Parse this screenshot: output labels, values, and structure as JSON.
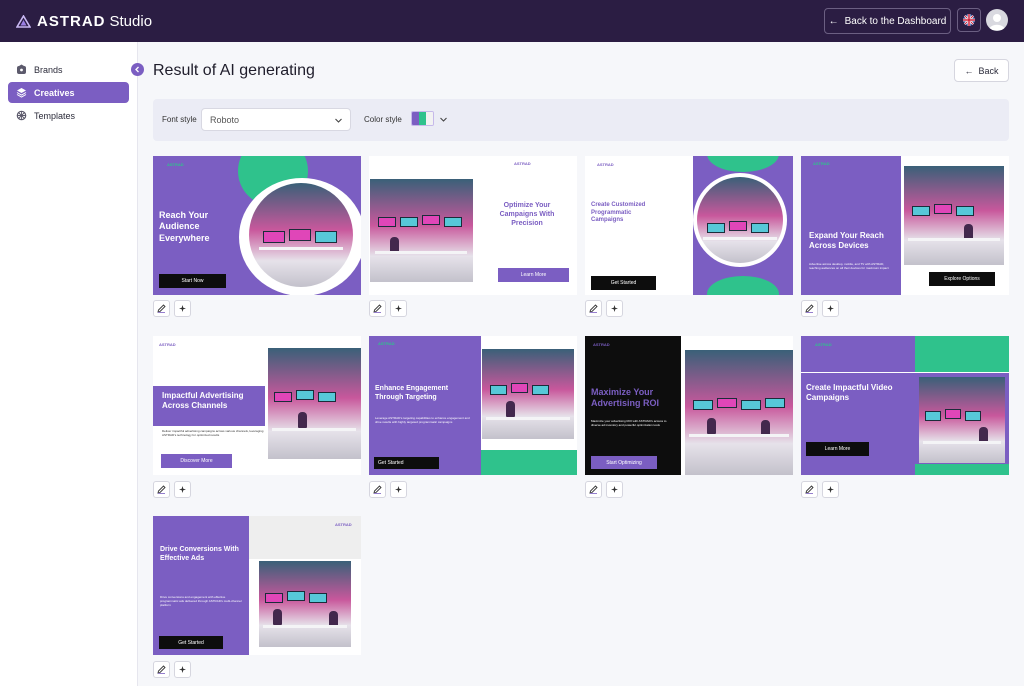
{
  "app": {
    "brand": "ASTRAD",
    "product": "Studio"
  },
  "topbar": {
    "back_to_dashboard": "Back to the Dashboard",
    "language_flag": "uk-flag-icon",
    "avatar": "user-avatar"
  },
  "sidebar": {
    "items": [
      {
        "label": "Brands",
        "icon": "brand-icon",
        "active": false
      },
      {
        "label": "Creatives",
        "icon": "layers-icon",
        "active": true
      },
      {
        "label": "Templates",
        "icon": "templates-icon",
        "active": false
      }
    ]
  },
  "page": {
    "title": "Result of AI generating",
    "back_label": "Back"
  },
  "filters": {
    "font_style_label": "Font style",
    "font_style_value": "Roboto",
    "color_style_label": "Color style"
  },
  "colors": {
    "accent": "#7b5ec2",
    "topbar": "#2b1d43",
    "green": "#2fc28c",
    "black": "#0d0d0d"
  },
  "creatives": [
    {
      "logo": "ASTRAD",
      "title": "Reach Your Audience Everywhere",
      "cta": "Start Now"
    },
    {
      "logo": "ASTRAD",
      "title": "Optimize Your Campaigns With Precision",
      "cta": "Learn More"
    },
    {
      "logo": "ASTRAD",
      "title": "Create Customized Programmatic Campaigns",
      "cta": "Get Started"
    },
    {
      "logo": "ASTRAD",
      "title": "Expand Your Reach Across Devices",
      "body": "Advertise across desktop, mobile, and TV with ASTRAD, reaching audiences on all their devices for maximum impact",
      "cta": "Explore Options"
    },
    {
      "logo": "ASTRAD",
      "title": "Impactful Advertising Across Channels",
      "body": "Deliver impactful advertising campaigns across various channels, leveraging ASTRAD's technology for optimized results",
      "cta": "Discover More"
    },
    {
      "logo": "ASTRAD",
      "title": "Enhance Engagement Through Targeting",
      "body": "Leverage ASTRAD's targeting capabilities to enhance engagement and drive results with highly targeted programmatic campaigns",
      "cta": "Get Started"
    },
    {
      "logo": "ASTRAD",
      "title": "Maximize Your Advertising ROI",
      "body": "Maximize your advertising ROI with ASTRAD's access to diverse ad inventory and powerful optimization tools",
      "cta": "Start Optimizing"
    },
    {
      "logo": "ASTRAD",
      "title": "Create Impactful Video Campaigns",
      "cta": "Learn More"
    },
    {
      "logo": "ASTRAD",
      "title": "Drive Conversions With Effective Ads",
      "body": "Drive conversions and engagement with effective programmatic ads delivered through ASTRAD's multi-channel platform",
      "cta": "Get Started"
    }
  ],
  "card_actions": {
    "edit": "pencil-icon",
    "ai": "sparkle-icon"
  }
}
